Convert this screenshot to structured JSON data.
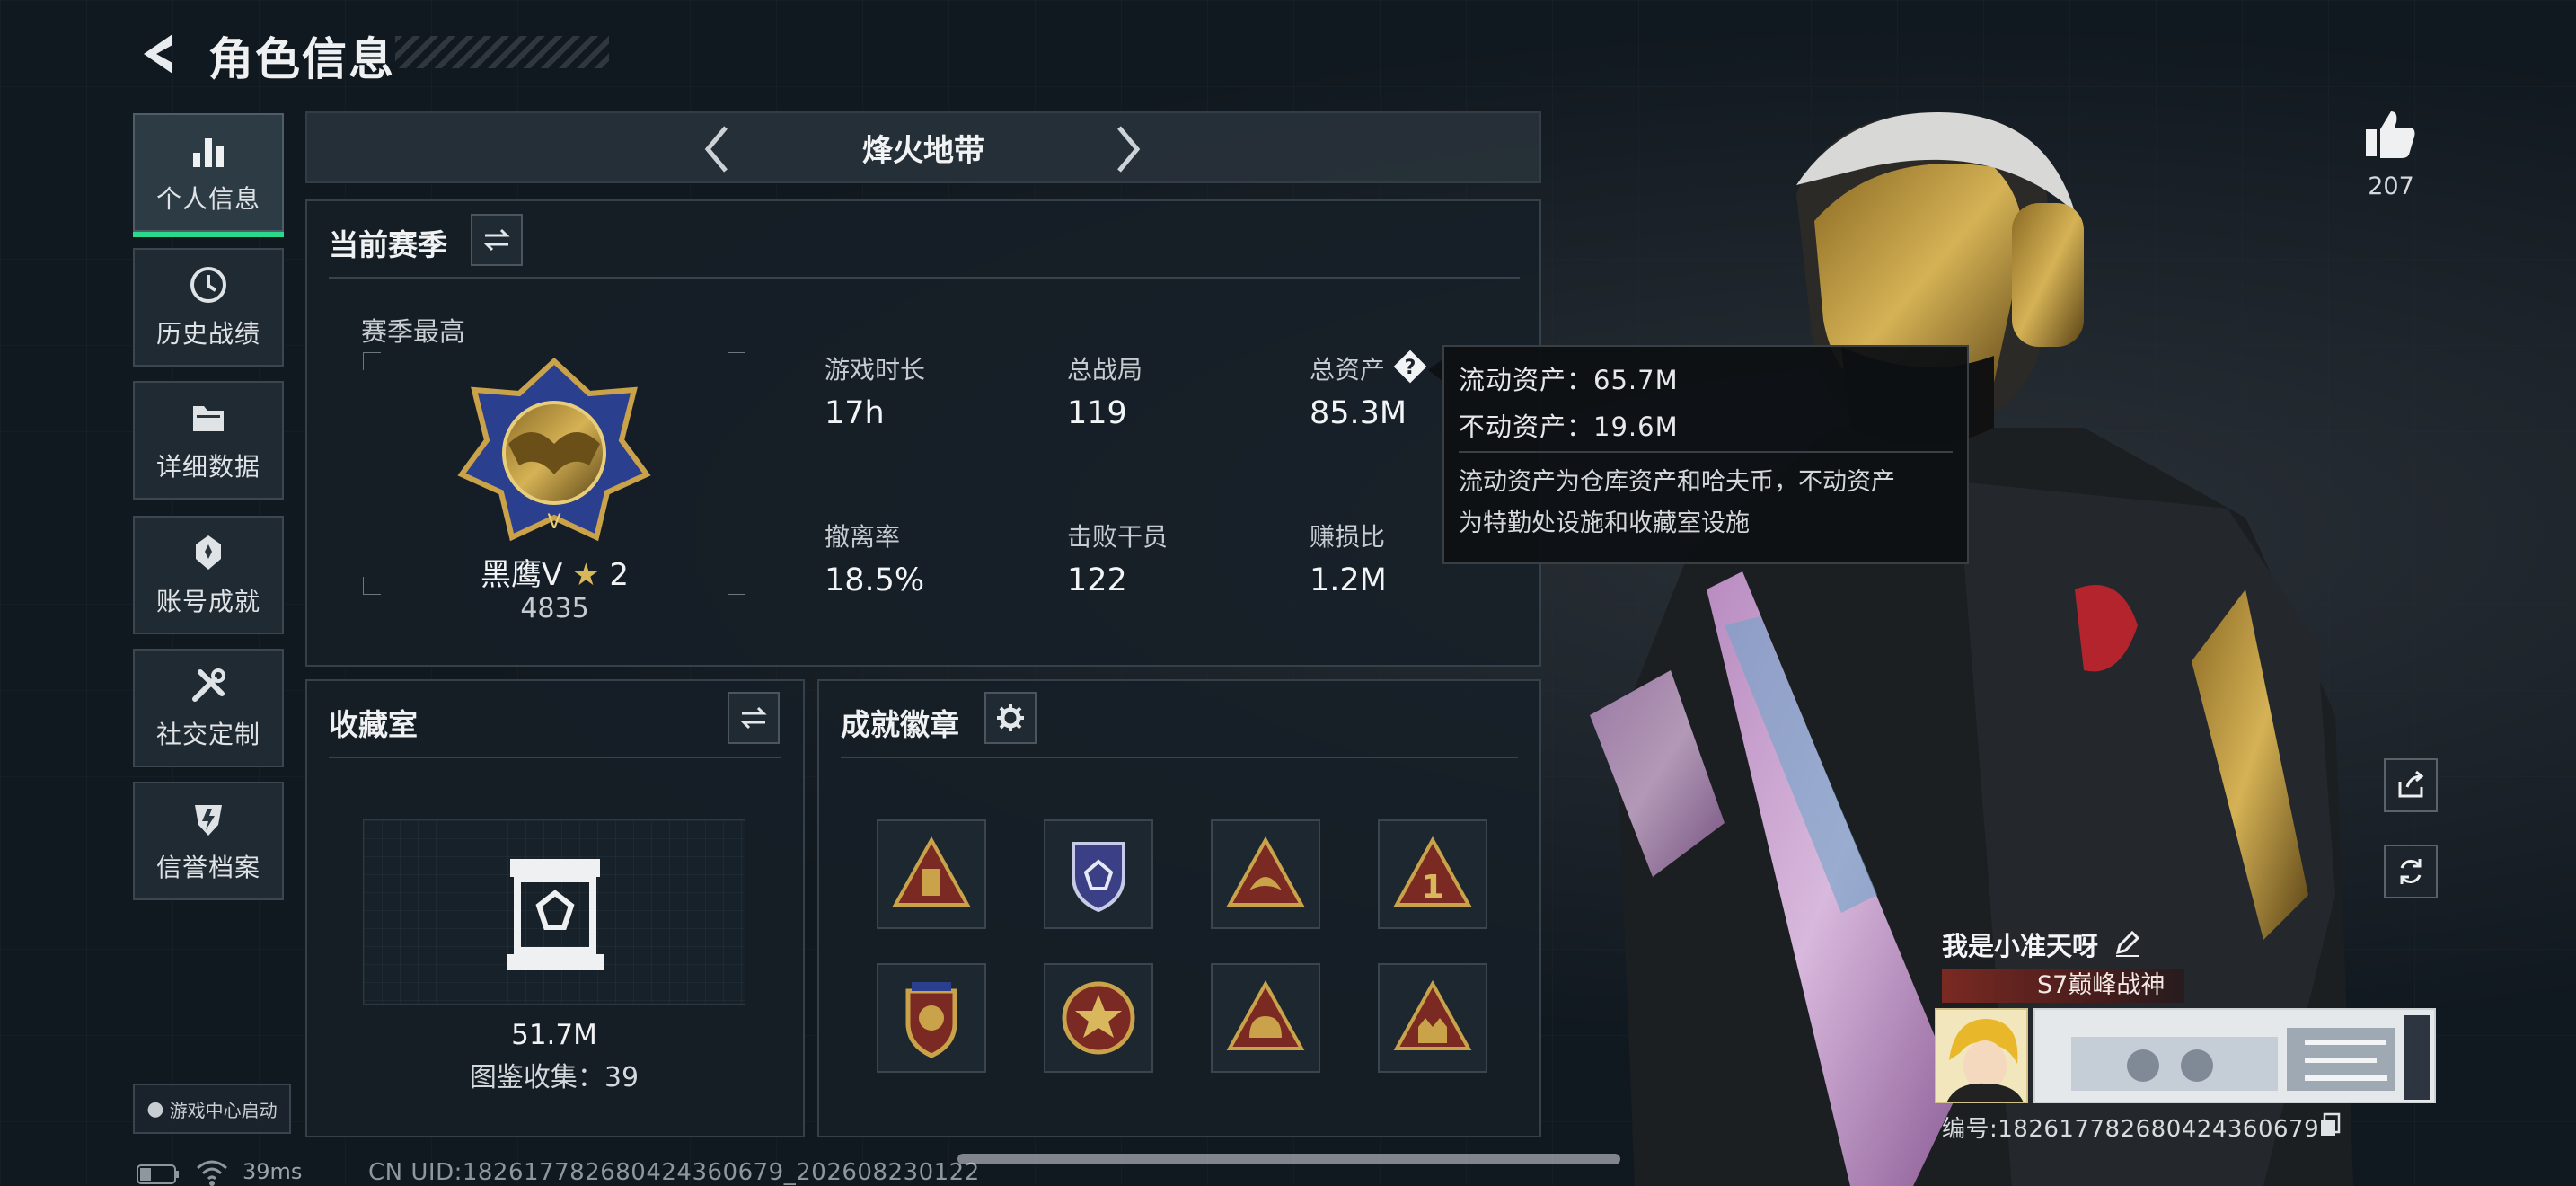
{
  "header": {
    "title": "角色信息"
  },
  "sidebar": {
    "items": [
      {
        "label": "个人信息",
        "icon": "bar-chart-icon",
        "active": true
      },
      {
        "label": "历史战绩",
        "icon": "history-icon"
      },
      {
        "label": "详细数据",
        "icon": "folder-icon"
      },
      {
        "label": "账号成就",
        "icon": "achievement-icon"
      },
      {
        "label": "社交定制",
        "icon": "tools-icon"
      },
      {
        "label": "信誉档案",
        "icon": "shield-icon"
      }
    ],
    "game_center": "游戏中心启动"
  },
  "mode_selector": {
    "label": "烽火地带"
  },
  "season": {
    "title": "当前赛季",
    "subtitle": "赛季最高",
    "rank_name": "黑鹰V",
    "rank_stars": "2",
    "rank_score": "4835",
    "stats": [
      {
        "label": "游戏时长",
        "value": "17h"
      },
      {
        "label": "总战局",
        "value": "119"
      },
      {
        "label": "总资产",
        "value": "85.3M"
      },
      {
        "label": "撤离率",
        "value": "18.5%"
      },
      {
        "label": "击败干员",
        "value": "122"
      },
      {
        "label": "赚损比",
        "value": "1.2M"
      }
    ]
  },
  "tooltip": {
    "liquid": "流动资产：65.7M",
    "fixed": "不动资产：19.6M",
    "desc_line1": "流动资产为仓库资产和哈夫币，不动资产",
    "desc_line2": "为特勤处设施和收藏室设施"
  },
  "collection": {
    "title": "收藏室",
    "value": "51.7M",
    "count": "图鉴收集：39"
  },
  "achievements": {
    "title": "成就徽章",
    "badges": [
      "badge-triangle-tower",
      "badge-shield-emblem",
      "badge-triangle-dragon",
      "badge-triangle-one",
      "badge-crest",
      "badge-star-seal",
      "badge-triangle-helmet",
      "badge-triangle-figures"
    ]
  },
  "like": {
    "count": "207"
  },
  "player": {
    "name": "我是小准天呀",
    "title": "S7巅峰战神",
    "id": "编号:182617782680424360679"
  },
  "status_bar": {
    "ping": "39ms",
    "uid": "CN UID:182617782680424360679_202608230122"
  },
  "colors": {
    "accent_green": "#29d98c",
    "badge_gold": "#c9a24a",
    "badge_red": "#7a2a22"
  }
}
